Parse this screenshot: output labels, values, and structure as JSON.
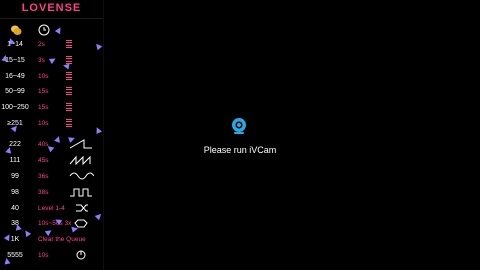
{
  "app": {
    "title": "LOVENSE"
  },
  "header": {
    "coin_icon": "coins-icon",
    "timer_icon": "clock-icon"
  },
  "rules": [
    {
      "level": "1~14",
      "duration": "2s",
      "action_icon": "bars-icon"
    },
    {
      "level": "15~15",
      "duration": "3s",
      "action_icon": "bars-icon"
    },
    {
      "level": "16~49",
      "duration": "10s",
      "action_icon": "bars-icon"
    },
    {
      "level": "50~99",
      "duration": "15s",
      "action_icon": "bars-icon"
    },
    {
      "level": "100~250",
      "duration": "15s",
      "action_icon": "bars-icon"
    },
    {
      "level": "≥251",
      "duration": "10s",
      "action_icon": "bars-icon"
    },
    {
      "level": "222",
      "duration": "40s",
      "action_icon": "ramp-wave-icon"
    },
    {
      "level": "111",
      "duration": "45s",
      "action_icon": "square-wave-icon"
    },
    {
      "level": "99",
      "duration": "36s",
      "action_icon": "sine-wave-icon"
    },
    {
      "level": "98",
      "duration": "38s",
      "action_icon": "pulse-wave-icon"
    },
    {
      "level": "40",
      "duration": "Level 1-4",
      "action_icon": "shuffle-icon"
    },
    {
      "level": "38",
      "duration": "10s~50s 3x",
      "action_icon": "rotate-icon"
    },
    {
      "level": "1K",
      "duration": "Clear the Queue",
      "action_icon": ""
    },
    {
      "level": "5555",
      "duration": "10s",
      "action_icon": "power-icon"
    }
  ],
  "main": {
    "message": "Please run iVCam",
    "icon": "webcam-icon"
  },
  "colors": {
    "accent": "#ff3f8e",
    "text": "#ffffff",
    "icon": "#2aa9e0",
    "deco": "#8f7cff"
  }
}
